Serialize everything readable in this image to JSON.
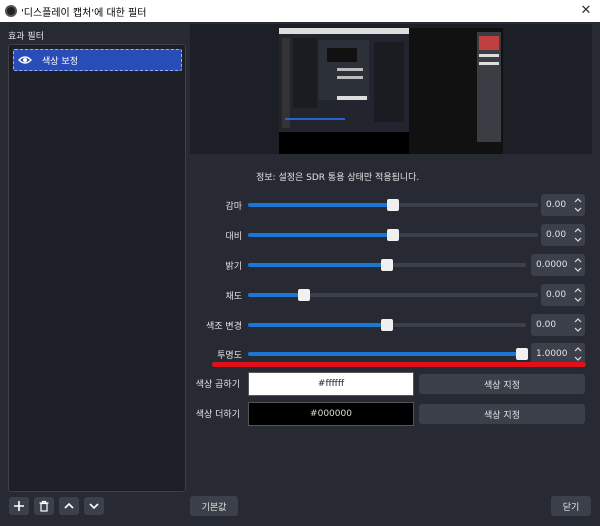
{
  "window": {
    "title": "'디스플레이 캡처'에 대한 필터",
    "close_glyph": "✕"
  },
  "filters": {
    "section_label": "효과 필터",
    "items": [
      {
        "label": "색상 보정"
      }
    ]
  },
  "properties": {
    "info": "정보: 설정은 SDR 통용 상태만 적용됩니다.",
    "sliders": [
      {
        "label": "감마",
        "value": "0.00",
        "fraction": 0.5
      },
      {
        "label": "대비",
        "value": "0.00",
        "fraction": 0.5
      },
      {
        "label": "밝기",
        "value": "0.0000",
        "fraction": 0.5
      },
      {
        "label": "채도",
        "value": "0.00",
        "fraction": 0.18
      },
      {
        "label": "색조 변경",
        "value": "0.00",
        "fraction": 0.5
      },
      {
        "label": "투명도",
        "value": "1.0000",
        "fraction": 1.0
      }
    ],
    "color_multiply": {
      "label": "색상 곱하기",
      "value": "#ffffff",
      "button": "색상 지정"
    },
    "color_add": {
      "label": "색상 더하기",
      "value": "#000000",
      "button": "색상 지정"
    }
  },
  "footer": {
    "defaults_button": "기본값",
    "close_button": "닫기"
  },
  "colors": {
    "accent": "#1c76d6",
    "highlight": "#e0101a",
    "selection": "#284cb8"
  }
}
